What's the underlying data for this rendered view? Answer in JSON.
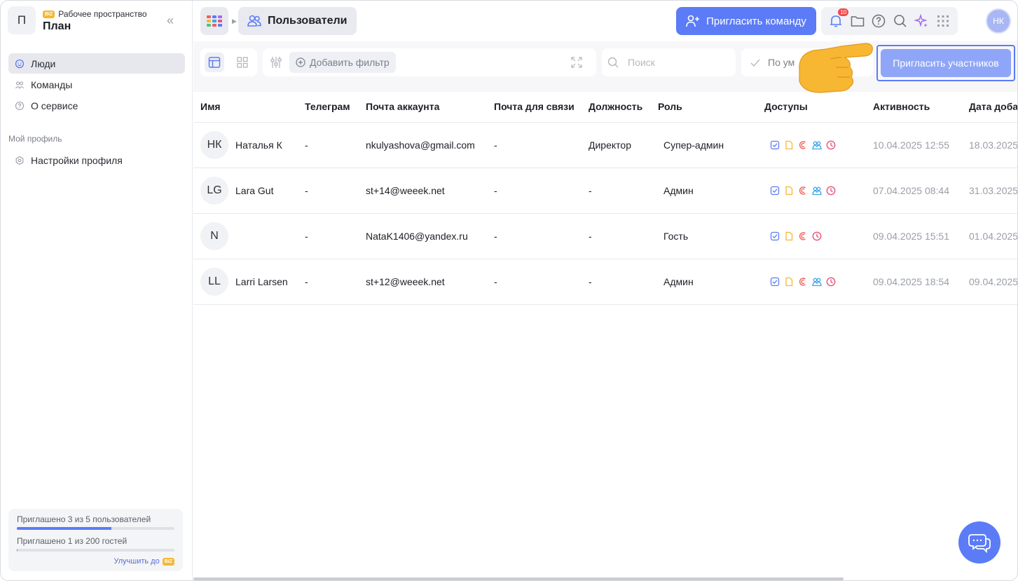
{
  "sidebar": {
    "workspace_initial": "П",
    "workspace_badge": "BIZ",
    "workspace_label": "Рабочее пространство",
    "workspace_name": "План",
    "collapse_glyph": "«",
    "items": [
      {
        "label": "Люди",
        "icon": "smile-icon",
        "active": true
      },
      {
        "label": "Команды",
        "icon": "team-icon",
        "active": false
      },
      {
        "label": "О сервисе",
        "icon": "help-icon",
        "active": false
      }
    ],
    "profile_section": "Мой профиль",
    "profile_items": [
      {
        "label": "Настройки профиля",
        "icon": "gear-icon"
      }
    ],
    "quota": {
      "users_text": "Приглашено 3 из 5 пользователей",
      "users_progress": 0.6,
      "guests_text": "Приглашено 1 из 200 гостей",
      "guests_progress": 0.005,
      "upgrade_label": "Улучшить до",
      "upgrade_badge": "BIZ"
    }
  },
  "topbar": {
    "breadcrumb_title": "Пользователи",
    "invite_team_label": "Пригласить команду",
    "notifications_count": "10",
    "user_initials": "НК"
  },
  "toolbar": {
    "add_filter_label": "Добавить фильтр",
    "search_placeholder": "Поиск",
    "sort_label": "По ум",
    "invite_members_label": "Пригласить участников"
  },
  "table": {
    "columns": [
      "Имя",
      "Телеграм",
      "Почта аккаунта",
      "Почта для связи",
      "Должность",
      "Роль",
      "Доступы",
      "Активность",
      "Дата доба"
    ],
    "rows": [
      {
        "initials": "НК",
        "name": "Наталья К",
        "telegram": "-",
        "account_email": "nkulyashova@gmail.com",
        "contact_email": "-",
        "position": "Директор",
        "role": "Супер-админ",
        "access": [
          "tasks",
          "docs",
          "crm",
          "teams",
          "time"
        ],
        "activity": "10.04.2025 12:55",
        "added": "18.03.2025"
      },
      {
        "initials": "LG",
        "name": "Lara Gut",
        "telegram": "-",
        "account_email": "st+14@weeek.net",
        "contact_email": "-",
        "position": "-",
        "role": "Админ",
        "access": [
          "tasks",
          "docs",
          "crm",
          "teams",
          "time"
        ],
        "activity": "07.04.2025 08:44",
        "added": "31.03.2025"
      },
      {
        "initials": "N",
        "name": "",
        "telegram": "-",
        "account_email": "NataK1406@yandex.ru",
        "contact_email": "-",
        "position": "-",
        "role": "Гость",
        "access": [
          "tasks",
          "docs",
          "crm",
          "time"
        ],
        "activity": "09.04.2025 15:51",
        "added": "01.04.2025"
      },
      {
        "initials": "LL",
        "name": "Larri Larsen",
        "telegram": "-",
        "account_email": "st+12@weeek.net",
        "contact_email": "-",
        "position": "-",
        "role": "Админ",
        "access": [
          "tasks",
          "docs",
          "crm",
          "teams",
          "time"
        ],
        "activity": "09.04.2025 18:54",
        "added": "09.04.2025"
      }
    ]
  },
  "colors": {
    "accent": "#5b7cf6",
    "tasks": "#5b7cf6",
    "docs": "#f7b733",
    "crm": "#f0605a",
    "teams": "#3aa6e8",
    "time": "#e5577a"
  }
}
